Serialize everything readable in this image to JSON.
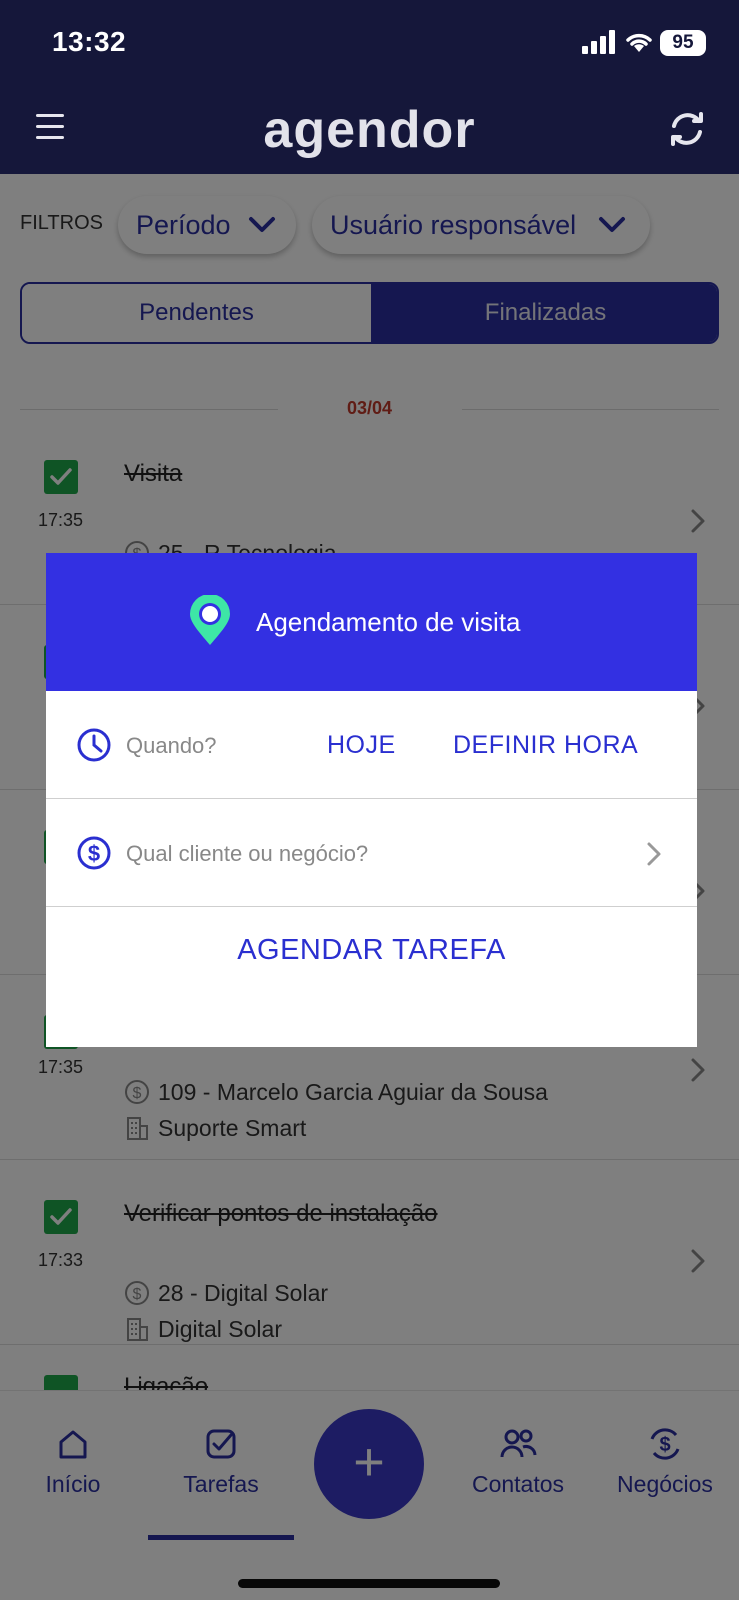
{
  "status": {
    "time": "13:32",
    "battery": "95"
  },
  "appbar": {
    "logo": "agendor"
  },
  "filters": {
    "label": "FILTROS",
    "period": "Período",
    "user": "Usuário responsável"
  },
  "tabs": {
    "pending": "Pendentes",
    "done": "Finalizadas"
  },
  "date": "03/04",
  "tasks": [
    {
      "title": "Visita",
      "time": "17:35",
      "deal": "25 - R Tecnologia",
      "company": ""
    },
    {
      "title": "",
      "time": "17:35",
      "deal": "109 - Marcelo Garcia Aguiar da Sousa",
      "company": "Suporte Smart"
    },
    {
      "title": "Verificar pontos de instalação",
      "time": "17:33",
      "deal": "28 - Digital Solar",
      "company": "Digital Solar"
    },
    {
      "title": "Ligação",
      "time": "",
      "deal": "",
      "company": ""
    }
  ],
  "modal": {
    "title": "Agendamento de visita",
    "when_placeholder": "Quando?",
    "today": "HOJE",
    "set_time": "DEFINIR HORA",
    "client_placeholder": "Qual cliente ou negócio?",
    "submit": "AGENDAR TAREFA"
  },
  "nav": {
    "home": "Início",
    "tasks": "Tarefas",
    "add": "+",
    "contacts": "Contatos",
    "deals": "Negócios"
  },
  "colors": {
    "primary": "#2a2fa0",
    "header": "#15173a",
    "modal_header": "#3330e2",
    "check": "#1ea84a",
    "date": "#c0392b"
  }
}
